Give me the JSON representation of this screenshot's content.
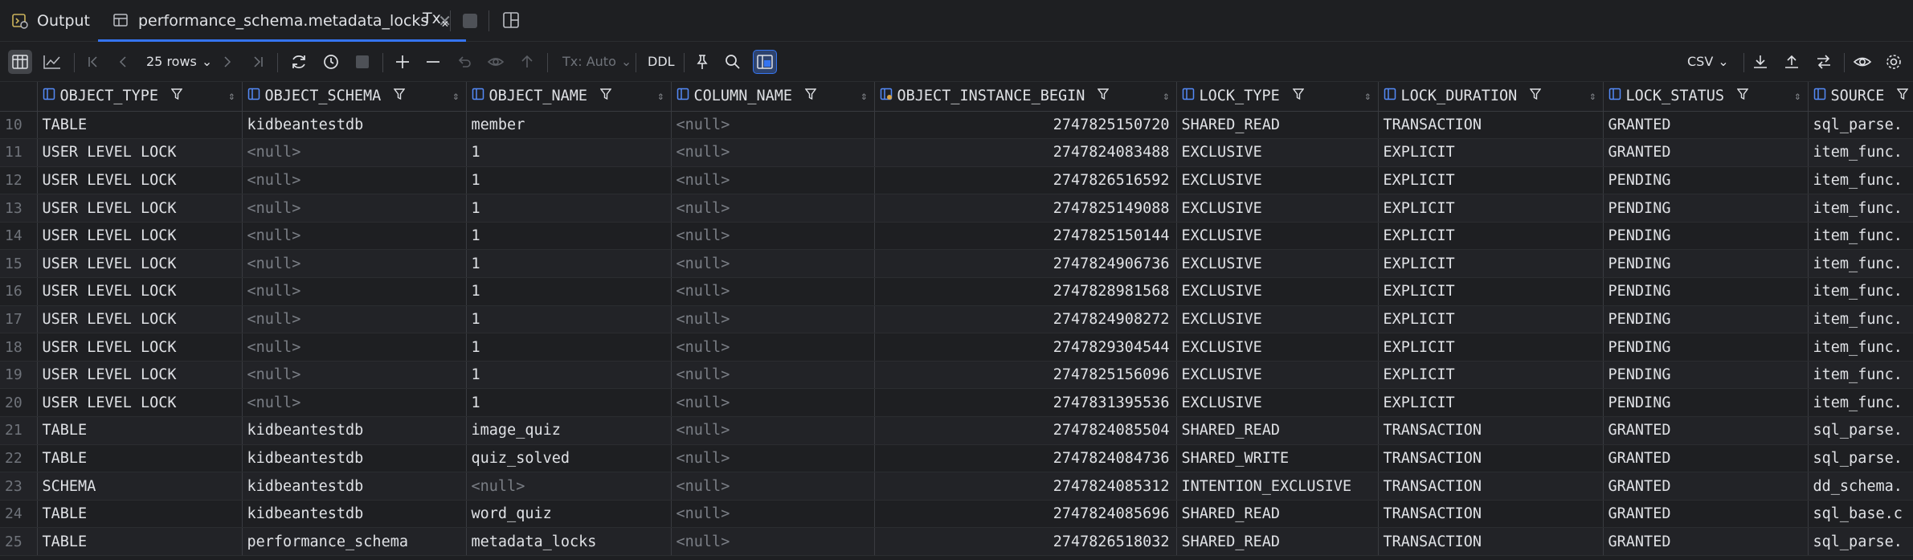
{
  "tabs": [
    {
      "label": "Output",
      "active": false,
      "icon": "output-console-icon"
    },
    {
      "label": "performance_schema.metadata_locks",
      "active": true,
      "icon": "table-icon",
      "closable": true
    }
  ],
  "tabbar_extra": {
    "tx_label": "Tx"
  },
  "toolbar": {
    "rows_label": "25 rows",
    "tx_mode": "Tx: Auto",
    "ddl_label": "DDL",
    "export_format": "CSV"
  },
  "colors": {
    "accent": "#3574f0",
    "background": "#1e1f22",
    "null_text": "#7a7e85"
  },
  "columns": [
    {
      "name": "OBJECT_TYPE",
      "icon": "column-icon"
    },
    {
      "name": "OBJECT_SCHEMA",
      "icon": "column-icon"
    },
    {
      "name": "OBJECT_NAME",
      "icon": "column-icon"
    },
    {
      "name": "COLUMN_NAME",
      "icon": "column-icon"
    },
    {
      "name": "OBJECT_INSTANCE_BEGIN",
      "icon": "key-column-icon"
    },
    {
      "name": "LOCK_TYPE",
      "icon": "column-icon"
    },
    {
      "name": "LOCK_DURATION",
      "icon": "column-icon"
    },
    {
      "name": "LOCK_STATUS",
      "icon": "column-icon"
    },
    {
      "name": "SOURCE",
      "icon": "column-icon"
    }
  ],
  "rows": [
    {
      "n": "10",
      "cells": [
        "TABLE",
        "kidbeantestdb",
        "member",
        "<null>",
        "2747825150720",
        "SHARED_READ",
        "TRANSACTION",
        "GRANTED",
        "sql_parse."
      ]
    },
    {
      "n": "11",
      "cells": [
        "USER LEVEL LOCK",
        "<null>",
        "1",
        "<null>",
        "2747824083488",
        "EXCLUSIVE",
        "EXPLICIT",
        "GRANTED",
        "item_func."
      ]
    },
    {
      "n": "12",
      "cells": [
        "USER LEVEL LOCK",
        "<null>",
        "1",
        "<null>",
        "2747826516592",
        "EXCLUSIVE",
        "EXPLICIT",
        "PENDING",
        "item_func."
      ]
    },
    {
      "n": "13",
      "cells": [
        "USER LEVEL LOCK",
        "<null>",
        "1",
        "<null>",
        "2747825149088",
        "EXCLUSIVE",
        "EXPLICIT",
        "PENDING",
        "item_func."
      ]
    },
    {
      "n": "14",
      "cells": [
        "USER LEVEL LOCK",
        "<null>",
        "1",
        "<null>",
        "2747825150144",
        "EXCLUSIVE",
        "EXPLICIT",
        "PENDING",
        "item_func."
      ]
    },
    {
      "n": "15",
      "cells": [
        "USER LEVEL LOCK",
        "<null>",
        "1",
        "<null>",
        "2747824906736",
        "EXCLUSIVE",
        "EXPLICIT",
        "PENDING",
        "item_func."
      ]
    },
    {
      "n": "16",
      "cells": [
        "USER LEVEL LOCK",
        "<null>",
        "1",
        "<null>",
        "2747828981568",
        "EXCLUSIVE",
        "EXPLICIT",
        "PENDING",
        "item_func."
      ]
    },
    {
      "n": "17",
      "cells": [
        "USER LEVEL LOCK",
        "<null>",
        "1",
        "<null>",
        "2747824908272",
        "EXCLUSIVE",
        "EXPLICIT",
        "PENDING",
        "item_func."
      ]
    },
    {
      "n": "18",
      "cells": [
        "USER LEVEL LOCK",
        "<null>",
        "1",
        "<null>",
        "2747829304544",
        "EXCLUSIVE",
        "EXPLICIT",
        "PENDING",
        "item_func."
      ]
    },
    {
      "n": "19",
      "cells": [
        "USER LEVEL LOCK",
        "<null>",
        "1",
        "<null>",
        "2747825156096",
        "EXCLUSIVE",
        "EXPLICIT",
        "PENDING",
        "item_func."
      ]
    },
    {
      "n": "20",
      "cells": [
        "USER LEVEL LOCK",
        "<null>",
        "1",
        "<null>",
        "2747831395536",
        "EXCLUSIVE",
        "EXPLICIT",
        "PENDING",
        "item_func."
      ]
    },
    {
      "n": "21",
      "cells": [
        "TABLE",
        "kidbeantestdb",
        "image_quiz",
        "<null>",
        "2747824085504",
        "SHARED_READ",
        "TRANSACTION",
        "GRANTED",
        "sql_parse."
      ]
    },
    {
      "n": "22",
      "cells": [
        "TABLE",
        "kidbeantestdb",
        "quiz_solved",
        "<null>",
        "2747824084736",
        "SHARED_WRITE",
        "TRANSACTION",
        "GRANTED",
        "sql_parse."
      ]
    },
    {
      "n": "23",
      "cells": [
        "SCHEMA",
        "kidbeantestdb",
        "<null>",
        "<null>",
        "2747824085312",
        "INTENTION_EXCLUSIVE",
        "TRANSACTION",
        "GRANTED",
        "dd_schema."
      ]
    },
    {
      "n": "24",
      "cells": [
        "TABLE",
        "kidbeantestdb",
        "word_quiz",
        "<null>",
        "2747824085696",
        "SHARED_READ",
        "TRANSACTION",
        "GRANTED",
        "sql_base.c"
      ]
    },
    {
      "n": "25",
      "cells": [
        "TABLE",
        "performance_schema",
        "metadata_locks",
        "<null>",
        "2747826518032",
        "SHARED_READ",
        "TRANSACTION",
        "GRANTED",
        "sql_parse."
      ]
    }
  ]
}
